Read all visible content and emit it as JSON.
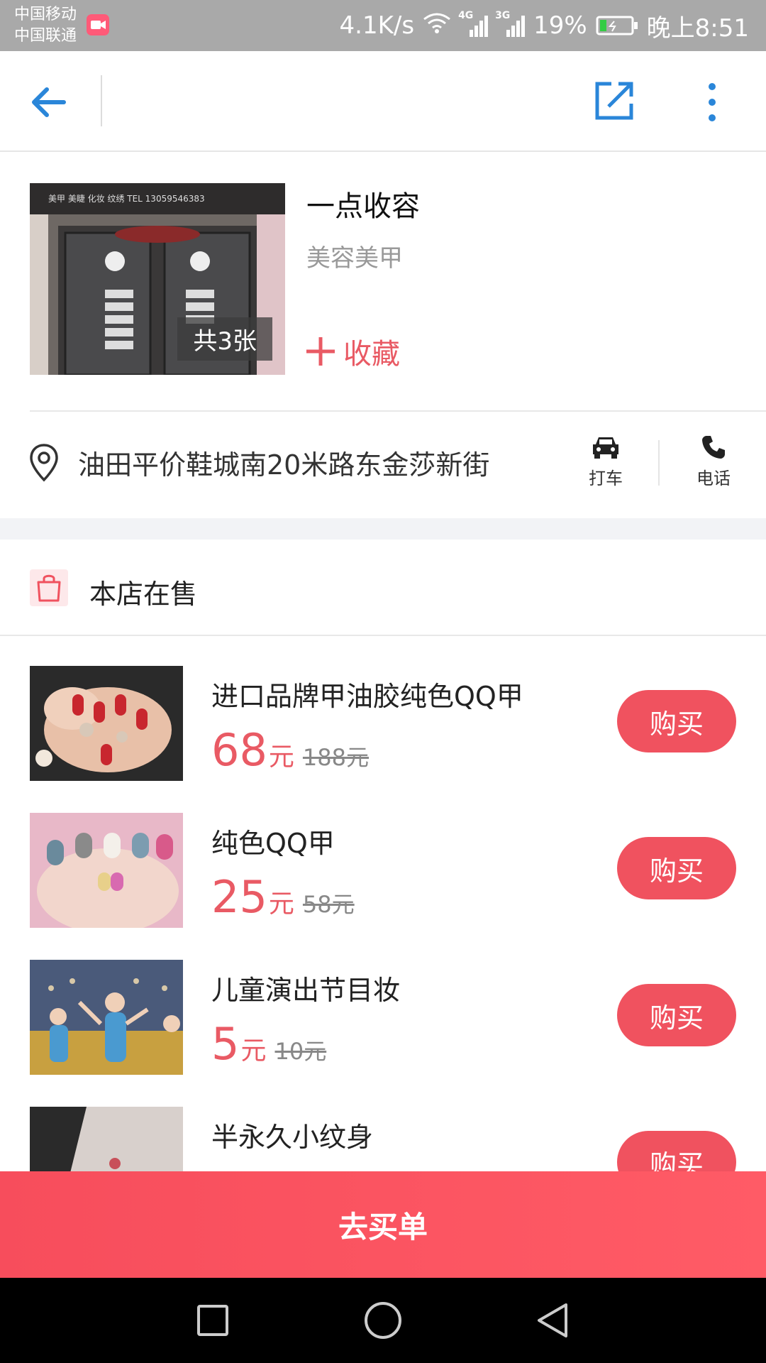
{
  "status_bar": {
    "carrier_1": "中国移动",
    "carrier_2": "中国联通",
    "net_speed": "4.1K/s",
    "net_4g": "4G",
    "net_3g": "3G",
    "battery": "19%",
    "time": "晚上8:51"
  },
  "shop": {
    "name": "一点收容",
    "category": "美容美甲",
    "photo_count": "共3张",
    "favorite_label": "收藏",
    "address": "油田平价鞋城南20米路东金莎新街",
    "taxi_label": "打车",
    "phone_label": "电话",
    "photo_sign_text": "美甲 美睫 化妆 纹绣  TEL 13059546383"
  },
  "section": {
    "title": "本店在售"
  },
  "products": [
    {
      "title": "进口品牌甲油胶纯色QQ甲",
      "price": "68",
      "unit": "元",
      "old_price": "188元",
      "buy": "购买"
    },
    {
      "title": "纯色QQ甲",
      "price": "25",
      "unit": "元",
      "old_price": "58元",
      "buy": "购买"
    },
    {
      "title": "儿童演出节目妆",
      "price": "5",
      "unit": "元",
      "old_price": "10元",
      "buy": "购买"
    },
    {
      "title": "半永久小纹身",
      "price": "",
      "unit": "",
      "old_price": "",
      "buy": "购买"
    }
  ],
  "cta": {
    "label": "去买单"
  },
  "colors": {
    "accent": "#f0525f",
    "nav_blue": "#2a86d9",
    "price_red": "#e95a64",
    "status_bar": "#a9a9a9"
  },
  "icons": [
    "back-arrow-icon",
    "share-icon",
    "more-icon",
    "plus-icon",
    "location-pin-icon",
    "taxi-icon",
    "phone-icon",
    "shopping-bag-icon"
  ]
}
